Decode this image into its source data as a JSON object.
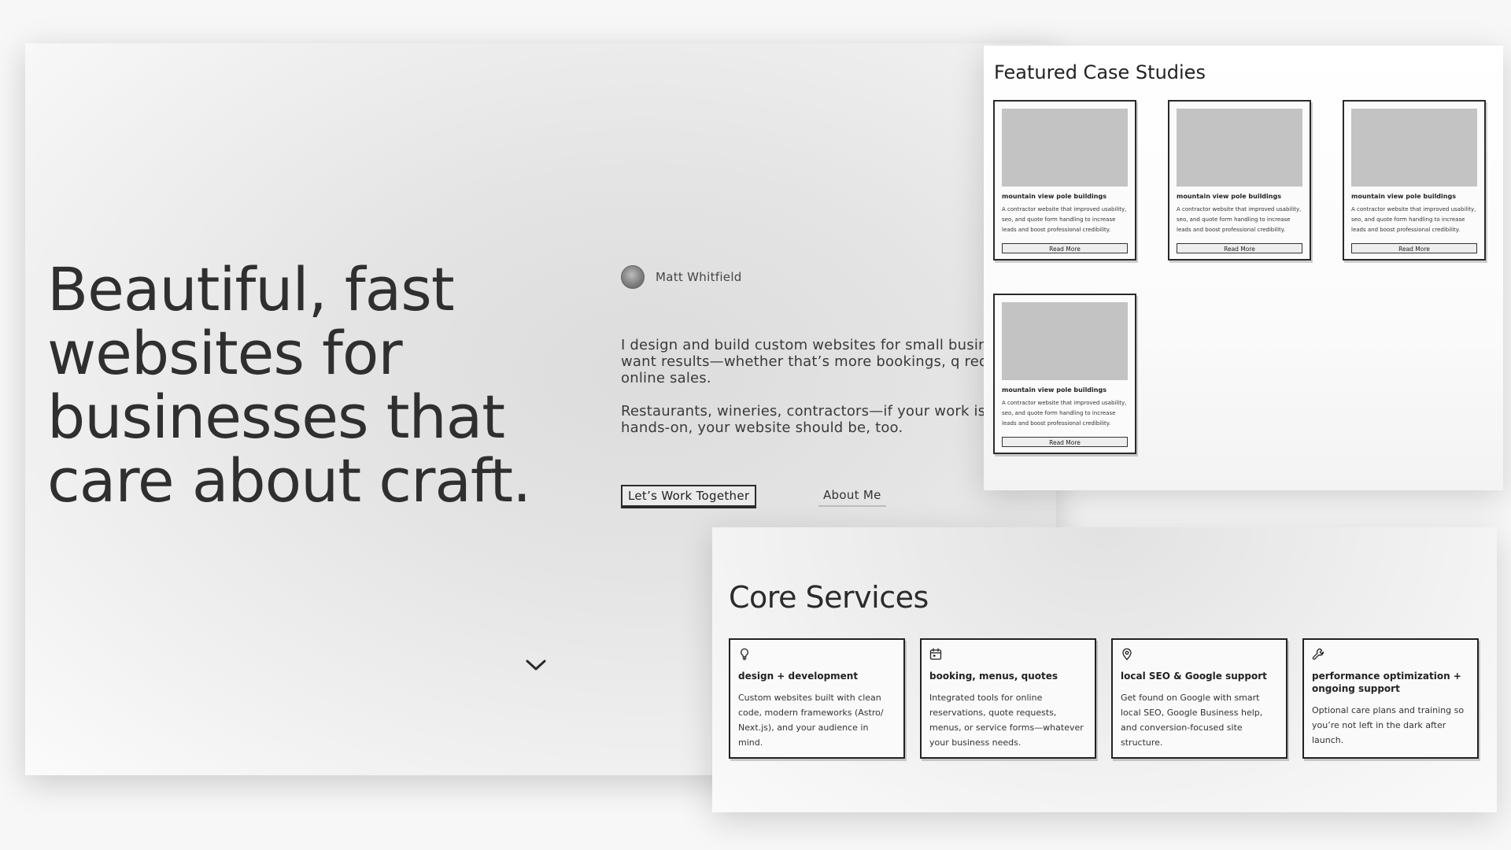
{
  "hero": {
    "title": "Beautiful, fast\nwebsites for\nbusinesses that\ncare about craft.",
    "author_name": "Matt Whitfield",
    "intro_p1": "I design and build custom websites for small busine that want results—whether that’s more bookings, q requests, or online sales.",
    "intro_p2": "Restaurants, wineries, contractors—if your work is and hands-on, your website should be, too.",
    "cta_label": "Let’s Work Together",
    "about_label": "About Me"
  },
  "case_studies": {
    "title": "Featured Case Studies",
    "items": [
      {
        "name": "mountain view pole buildings",
        "description": "A contractor website that improved usability, seo, and quote form handling to increase leads and boost professional credibility.",
        "button": "Read More"
      },
      {
        "name": "mountain view pole buildings",
        "description": "A contractor website that improved usability, seo, and quote form handling to increase leads and boost professional credibility.",
        "button": "Read More"
      },
      {
        "name": "mountain view pole buildings",
        "description": "A contractor website that improved usability, seo, and quote form handling to increase leads and boost professional credibility.",
        "button": "Read More"
      },
      {
        "name": "mountain view pole buildings",
        "description": "A contractor website that improved usability, seo, and quote form handling to increase leads and boost professional credibility.",
        "button": "Read More"
      }
    ]
  },
  "services": {
    "title": "Core Services",
    "items": [
      {
        "icon": "lightbulb-icon",
        "name": "design + development",
        "description": "Custom websites built with clean code, modern frameworks (Astro/ Next.js), and your audience in mind."
      },
      {
        "icon": "calendar-icon",
        "name": "booking, menus, quotes",
        "description": "Integrated tools for online reservations, quote requests, menus, or service forms—whatever your business needs."
      },
      {
        "icon": "map-pin-icon",
        "name": "local SEO & Google support",
        "description": "Get found on Google with smart local SEO, Google Business help, and conversion-focused site structure."
      },
      {
        "icon": "wrench-icon",
        "name": "performance optimization + ongoing support",
        "description": "Optional care plans and training so you’re not left in the dark after launch."
      }
    ]
  }
}
